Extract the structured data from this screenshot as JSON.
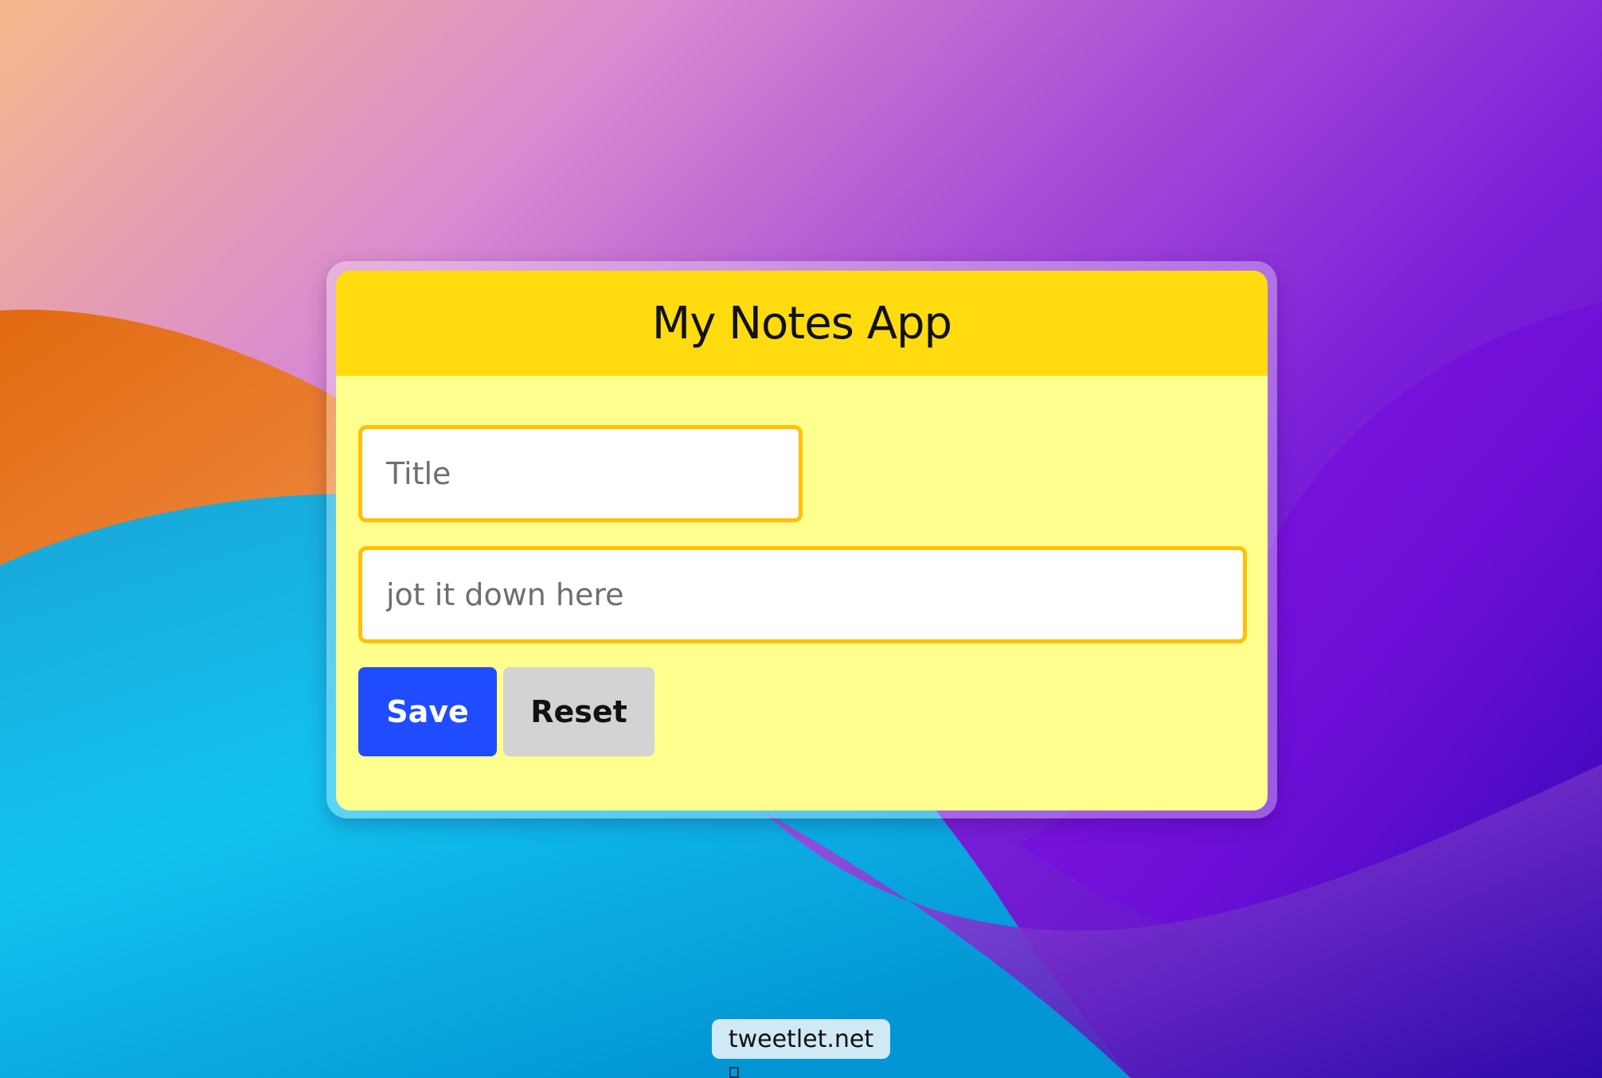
{
  "app": {
    "title": "My Notes App"
  },
  "form": {
    "title_placeholder": "Title",
    "title_value": "",
    "body_placeholder": "jot it down here",
    "body_value": "",
    "save_label": "Save",
    "reset_label": "Reset"
  },
  "watermark": {
    "text": "tweetlet.net"
  },
  "colors": {
    "header_bg": "#ffdb10",
    "card_bg": "#ffff8d",
    "field_border": "#ffc107",
    "save_bg": "#1f4cff",
    "reset_bg": "#d3d3d3"
  }
}
